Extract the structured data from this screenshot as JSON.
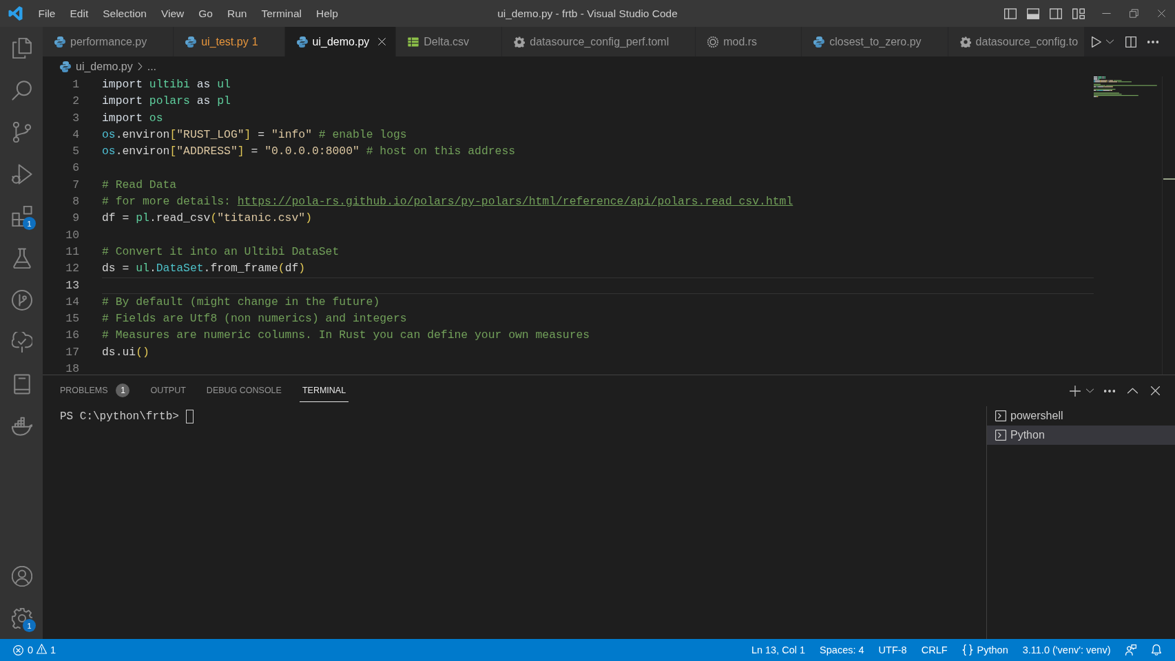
{
  "title_bar": {
    "menu": [
      "File",
      "Edit",
      "Selection",
      "View",
      "Go",
      "Run",
      "Terminal",
      "Help"
    ],
    "title": "ui_demo.py - frtb - Visual Studio Code",
    "layout_toggles": [
      {
        "kind": "primary-sidebar",
        "on": false
      },
      {
        "kind": "panel",
        "on": true
      },
      {
        "kind": "secondary-sidebar",
        "on": false
      }
    ]
  },
  "activity_bar": {
    "items": [
      {
        "kind": "files",
        "selected": false
      },
      {
        "kind": "search",
        "selected": false
      },
      {
        "kind": "source-control",
        "selected": false
      },
      {
        "kind": "run",
        "selected": false
      },
      {
        "kind": "extensions",
        "selected": false,
        "badge": "1"
      },
      {
        "kind": "testing",
        "selected": false
      },
      {
        "kind": "git-graph",
        "selected": false
      },
      {
        "kind": "tree",
        "selected": false
      },
      {
        "kind": "device",
        "selected": false
      },
      {
        "kind": "whale",
        "selected": false
      }
    ],
    "bottom": [
      {
        "kind": "account"
      },
      {
        "kind": "settings",
        "badge": "1"
      }
    ]
  },
  "editor_tabs": [
    {
      "label": "performance.py",
      "kind": "python",
      "selected": false,
      "warning": false
    },
    {
      "label": "ui_test.py",
      "badge": "1",
      "kind": "python",
      "selected": false,
      "warning": true
    },
    {
      "label": "ui_demo.py",
      "kind": "python",
      "selected": true,
      "warning": false
    },
    {
      "label": "Delta.csv",
      "kind": "table",
      "selected": false,
      "warning": false
    },
    {
      "label": "datasource_config_perf.toml",
      "kind": "gear",
      "selected": false,
      "warning": false
    },
    {
      "label": "mod.rs",
      "kind": "ring",
      "selected": false,
      "warning": false
    },
    {
      "label": "closest_to_zero.py",
      "kind": "python",
      "selected": false,
      "warning": false
    },
    {
      "label": "datasource_config.to",
      "kind": "gear",
      "selected": false,
      "warning": false
    }
  ],
  "breadcrumb": [
    {
      "label": "ui_demo.py",
      "kind": "python"
    },
    {
      "label": "...",
      "kind": "text"
    }
  ],
  "editor": {
    "lines": [
      {
        "number": "1",
        "current": false,
        "tokens": [
          {
            "kind": "keyword",
            "text": "import "
          },
          {
            "kind": "module",
            "text": "ultibi "
          },
          {
            "kind": "keyword",
            "text": "as "
          },
          {
            "kind": "module",
            "text": "ul"
          }
        ]
      },
      {
        "number": "2",
        "current": false,
        "tokens": [
          {
            "kind": "keyword",
            "text": "import "
          },
          {
            "kind": "module",
            "text": "polars "
          },
          {
            "kind": "keyword",
            "text": "as "
          },
          {
            "kind": "module",
            "text": "pl"
          }
        ]
      },
      {
        "number": "3",
        "current": false,
        "tokens": [
          {
            "kind": "keyword",
            "text": "import "
          },
          {
            "kind": "module",
            "text": "os"
          }
        ]
      },
      {
        "number": "4",
        "current": false,
        "tokens": [
          {
            "kind": "variable",
            "text": "os"
          },
          {
            "kind": "plain",
            "text": ".environ"
          },
          {
            "kind": "bracket",
            "text": "["
          },
          {
            "kind": "string",
            "text": "\"RUST_LOG\""
          },
          {
            "kind": "bracket",
            "text": "]"
          },
          {
            "kind": "plain",
            "text": " = "
          },
          {
            "kind": "string",
            "text": "\"info\""
          },
          {
            "kind": "comment",
            "text": " # enable logs"
          }
        ]
      },
      {
        "number": "5",
        "current": false,
        "tokens": [
          {
            "kind": "variable",
            "text": "os"
          },
          {
            "kind": "plain",
            "text": ".environ"
          },
          {
            "kind": "bracket",
            "text": "["
          },
          {
            "kind": "string",
            "text": "\"ADDRESS\""
          },
          {
            "kind": "bracket",
            "text": "]"
          },
          {
            "kind": "plain",
            "text": " = "
          },
          {
            "kind": "string",
            "text": "\"0.0.0.0:8000\""
          },
          {
            "kind": "comment",
            "text": " # host on this address"
          }
        ]
      },
      {
        "number": "6",
        "current": false
      },
      {
        "number": "7",
        "current": false,
        "tokens": [
          {
            "kind": "comment",
            "text": "# Read Data"
          }
        ]
      },
      {
        "number": "8",
        "current": false,
        "tokens": [
          {
            "kind": "comment",
            "text": "# for more details: "
          },
          {
            "kind": "link",
            "text": "https://pola-rs.github.io/polars/py-polars/html/reference/api/polars.read_csv.html"
          }
        ]
      },
      {
        "number": "9",
        "current": false,
        "tokens": [
          {
            "kind": "plain",
            "text": "df = "
          },
          {
            "kind": "module",
            "text": "pl"
          },
          {
            "kind": "plain",
            "text": ".read_csv"
          },
          {
            "kind": "bracket",
            "text": "("
          },
          {
            "kind": "string",
            "text": "\"titanic.csv\""
          },
          {
            "kind": "bracket",
            "text": ")"
          }
        ]
      },
      {
        "number": "10",
        "current": false
      },
      {
        "number": "11",
        "current": false,
        "tokens": [
          {
            "kind": "comment",
            "text": "# Convert it into an Ultibi DataSet"
          }
        ]
      },
      {
        "number": "12",
        "current": false,
        "tokens": [
          {
            "kind": "plain",
            "text": "ds = "
          },
          {
            "kind": "module",
            "text": "ul"
          },
          {
            "kind": "plain",
            "text": "."
          },
          {
            "kind": "class",
            "text": "DataSet"
          },
          {
            "kind": "plain",
            "text": ".from_frame"
          },
          {
            "kind": "bracket",
            "text": "("
          },
          {
            "kind": "plain",
            "text": "df"
          },
          {
            "kind": "bracket",
            "text": ")"
          }
        ]
      },
      {
        "number": "13",
        "current": true
      },
      {
        "number": "14",
        "current": false,
        "tokens": [
          {
            "kind": "comment",
            "text": "# By default (might change in the future)"
          }
        ]
      },
      {
        "number": "15",
        "current": false,
        "tokens": [
          {
            "kind": "comment",
            "text": "# Fields are Utf8 (non numerics) and integers"
          }
        ]
      },
      {
        "number": "16",
        "current": false,
        "tokens": [
          {
            "kind": "comment",
            "text": "# Measures are numeric columns. In Rust you can define your own measures"
          }
        ]
      },
      {
        "number": "17",
        "current": false,
        "tokens": [
          {
            "kind": "plain",
            "text": "ds.ui"
          },
          {
            "kind": "bracket",
            "text": "()"
          }
        ]
      },
      {
        "number": "18",
        "current": false
      }
    ]
  },
  "panel": {
    "tabs": [
      {
        "label": "PROBLEMS",
        "badge": "1",
        "selected": false
      },
      {
        "label": "OUTPUT",
        "selected": false
      },
      {
        "label": "DEBUG CONSOLE",
        "selected": false
      },
      {
        "label": "TERMINAL",
        "selected": true
      }
    ],
    "terminal": {
      "prompt": "PS C:\\python\\frtb>"
    },
    "terminals": [
      {
        "label": "powershell",
        "selected": false
      },
      {
        "label": "Python",
        "selected": true
      }
    ]
  },
  "status_bar": {
    "errors": "0",
    "warnings": "1",
    "items": [
      {
        "kind": "text",
        "label": "Ln 13, Col 1"
      },
      {
        "kind": "text",
        "label": "Spaces: 4"
      },
      {
        "kind": "text",
        "label": "UTF-8"
      },
      {
        "kind": "text",
        "label": "CRLF"
      },
      {
        "kind": "language",
        "label": "Python"
      },
      {
        "kind": "text",
        "label": "3.11.0 ('venv': venv)"
      },
      {
        "kind": "feedback"
      },
      {
        "kind": "bell"
      }
    ]
  }
}
